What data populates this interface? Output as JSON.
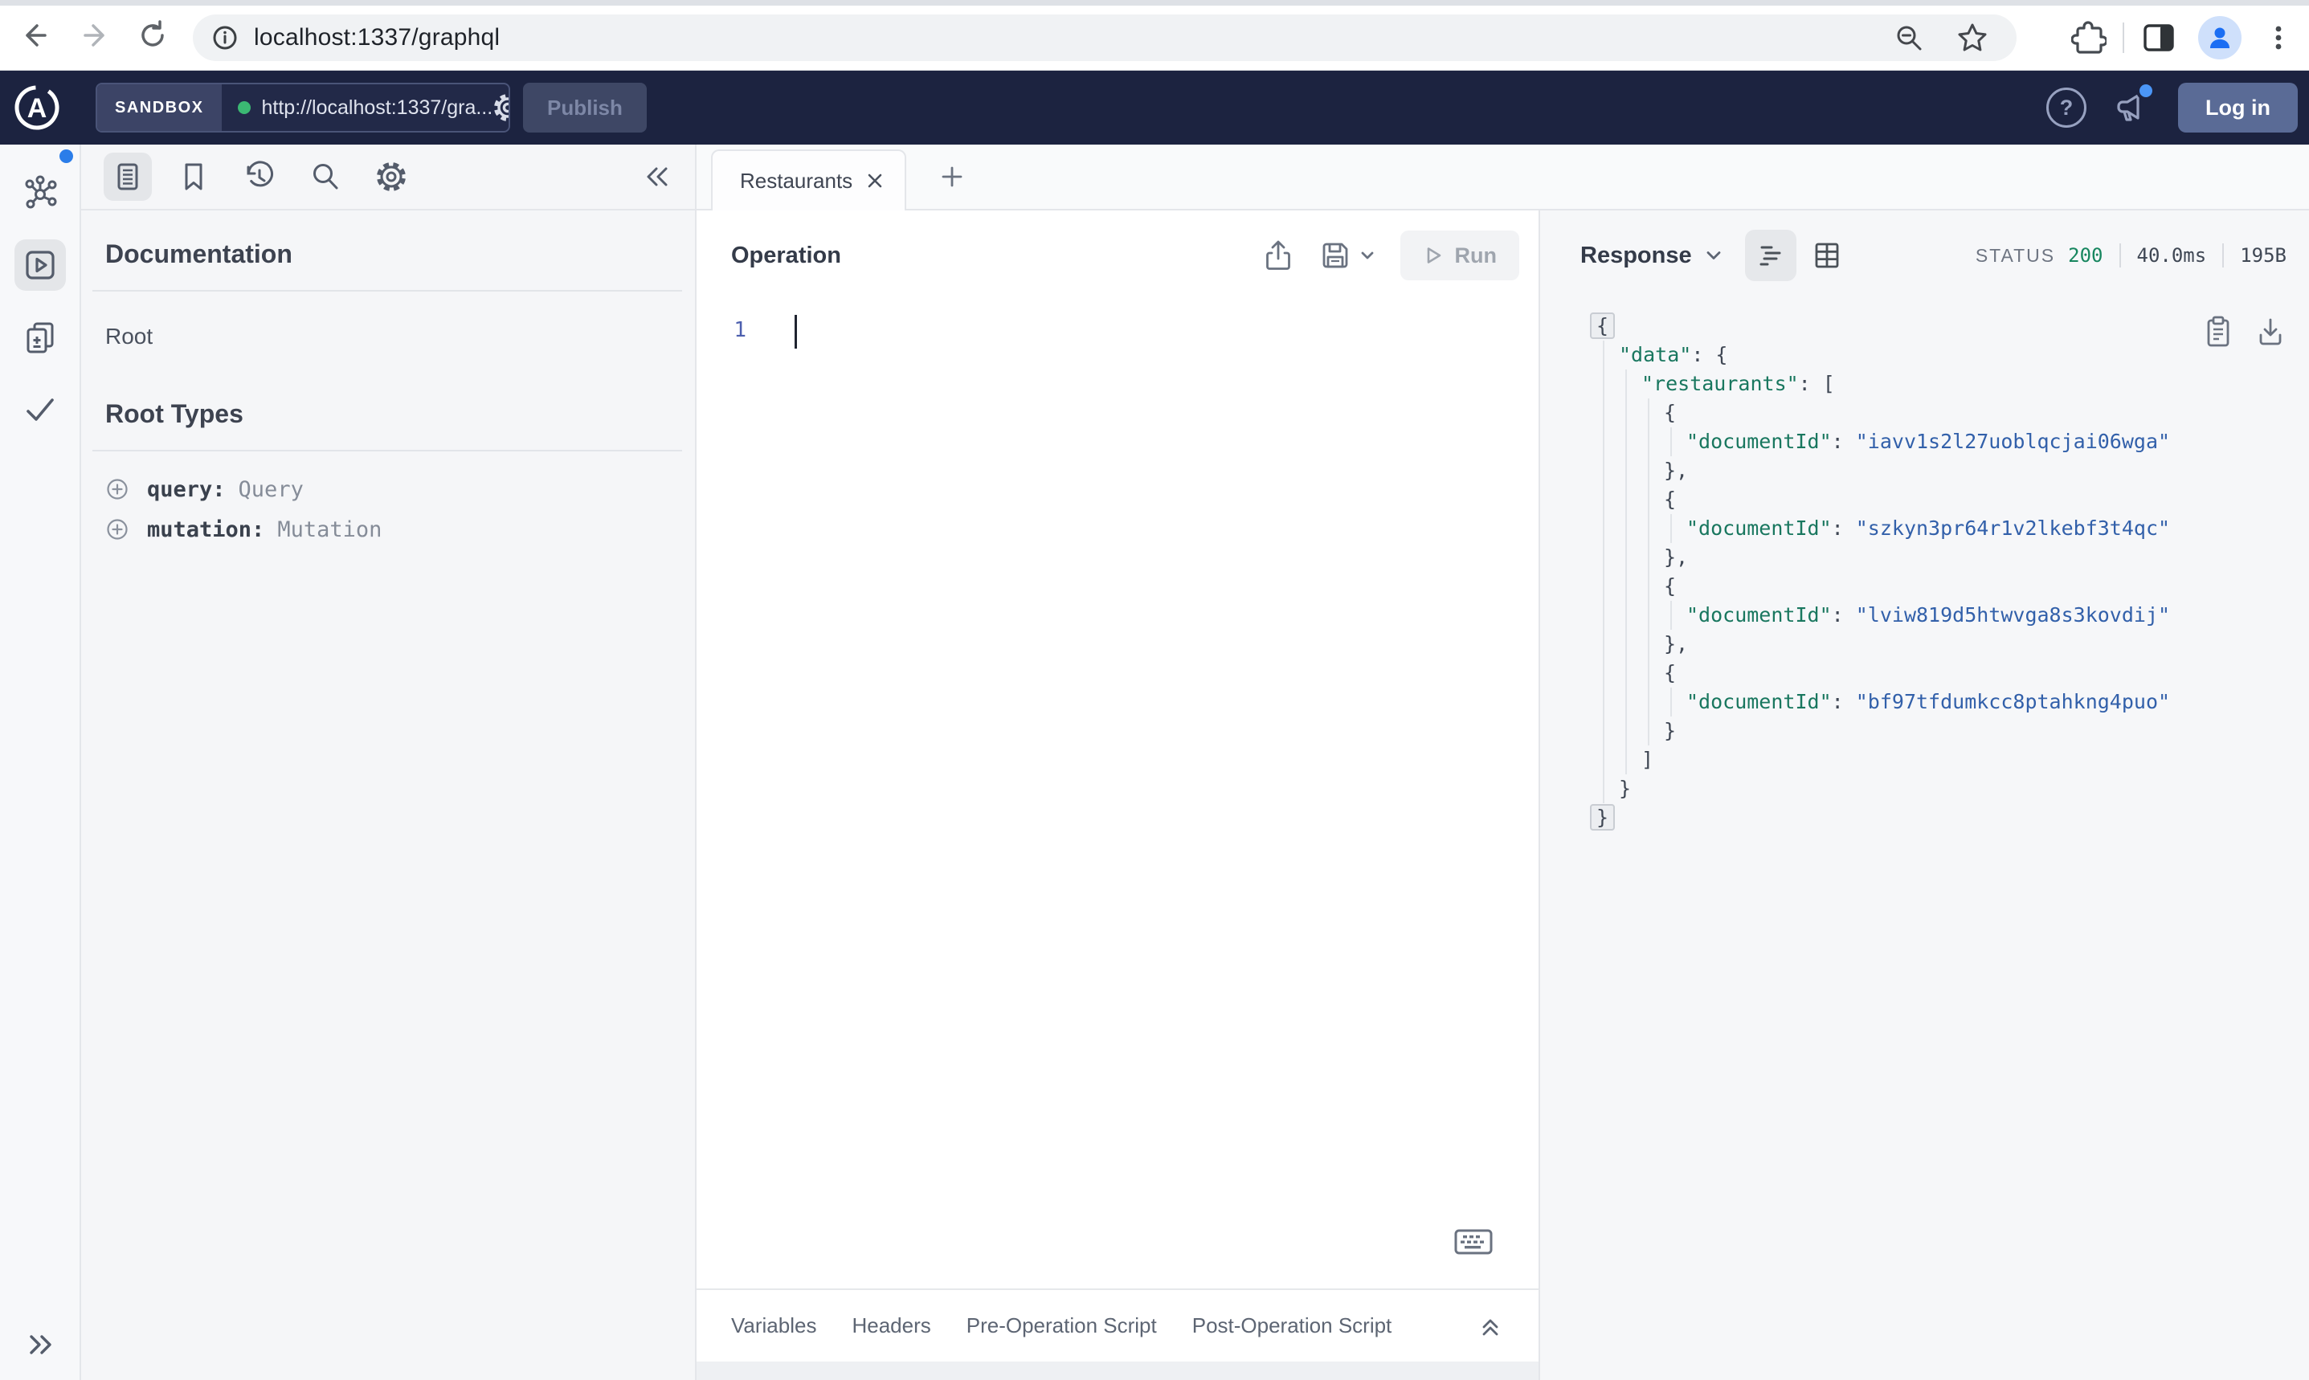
{
  "browser": {
    "url": "localhost:1337/graphql"
  },
  "apollo": {
    "logo_letter": "A",
    "badge": "SANDBOX",
    "endpoint": "http://localhost:1337/gra...",
    "publish_label": "Publish",
    "help_glyph": "?",
    "login_label": "Log in"
  },
  "docs": {
    "title": "Documentation",
    "root_label": "Root",
    "root_types_title": "Root Types",
    "root_types": [
      {
        "field": "query:",
        "type": "Query"
      },
      {
        "field": "mutation:",
        "type": "Mutation"
      }
    ]
  },
  "tabs": {
    "active_label": "Restaurants"
  },
  "operation": {
    "title": "Operation",
    "run_label": "Run",
    "line_number": "1"
  },
  "footer": {
    "tabs": [
      "Variables",
      "Headers",
      "Pre-Operation Script",
      "Post-Operation Script"
    ]
  },
  "response": {
    "title": "Response",
    "status_label": "STATUS",
    "status_code": "200",
    "time": "40.0ms",
    "size": "195B",
    "json_lines": [
      {
        "i": 0,
        "fold": true,
        "parts": [
          {
            "c": "p",
            "t": "{"
          }
        ]
      },
      {
        "i": 1,
        "parts": [
          {
            "c": "k",
            "t": "\"data\""
          },
          {
            "c": "p",
            "t": ": {"
          }
        ]
      },
      {
        "i": 2,
        "parts": [
          {
            "c": "k",
            "t": "\"restaurants\""
          },
          {
            "c": "p",
            "t": ": ["
          }
        ]
      },
      {
        "i": 3,
        "parts": [
          {
            "c": "p",
            "t": "{"
          }
        ]
      },
      {
        "i": 4,
        "parts": [
          {
            "c": "k",
            "t": "\"documentId\""
          },
          {
            "c": "p",
            "t": ": "
          },
          {
            "c": "s",
            "t": "\"iavv1s2l27uoblqcjai06wga\""
          }
        ]
      },
      {
        "i": 3,
        "parts": [
          {
            "c": "p",
            "t": "},"
          }
        ]
      },
      {
        "i": 3,
        "parts": [
          {
            "c": "p",
            "t": "{"
          }
        ]
      },
      {
        "i": 4,
        "parts": [
          {
            "c": "k",
            "t": "\"documentId\""
          },
          {
            "c": "p",
            "t": ": "
          },
          {
            "c": "s",
            "t": "\"szkyn3pr64r1v2lkebf3t4qc\""
          }
        ]
      },
      {
        "i": 3,
        "parts": [
          {
            "c": "p",
            "t": "},"
          }
        ]
      },
      {
        "i": 3,
        "parts": [
          {
            "c": "p",
            "t": "{"
          }
        ]
      },
      {
        "i": 4,
        "parts": [
          {
            "c": "k",
            "t": "\"documentId\""
          },
          {
            "c": "p",
            "t": ": "
          },
          {
            "c": "s",
            "t": "\"lviw819d5htwvga8s3kovdij\""
          }
        ]
      },
      {
        "i": 3,
        "parts": [
          {
            "c": "p",
            "t": "},"
          }
        ]
      },
      {
        "i": 3,
        "parts": [
          {
            "c": "p",
            "t": "{"
          }
        ]
      },
      {
        "i": 4,
        "parts": [
          {
            "c": "k",
            "t": "\"documentId\""
          },
          {
            "c": "p",
            "t": ": "
          },
          {
            "c": "s",
            "t": "\"bf97tfdumkcc8ptahkng4puo\""
          }
        ]
      },
      {
        "i": 3,
        "parts": [
          {
            "c": "p",
            "t": "}"
          }
        ]
      },
      {
        "i": 2,
        "parts": [
          {
            "c": "p",
            "t": "]"
          }
        ]
      },
      {
        "i": 1,
        "parts": [
          {
            "c": "p",
            "t": "}"
          }
        ]
      },
      {
        "i": 0,
        "fold": true,
        "parts": [
          {
            "c": "p",
            "t": "}"
          }
        ]
      }
    ]
  },
  "colors": {
    "header_bg": "#1c2340",
    "status_green": "#17865f",
    "json_key": "#19775f",
    "json_string": "#3260aa",
    "accent_blue": "#2b7de9"
  }
}
